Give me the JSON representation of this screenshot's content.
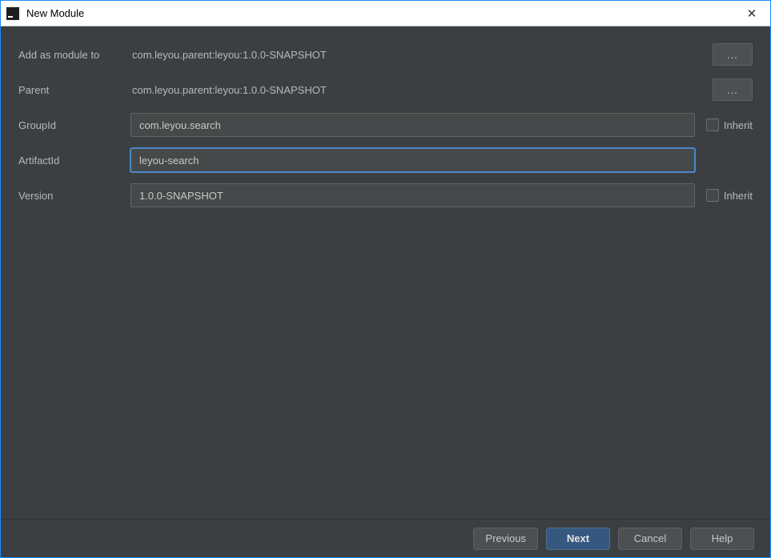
{
  "window": {
    "title": "New Module",
    "close_glyph": "✕"
  },
  "form": {
    "add_module_label": "Add as module to",
    "add_module_value": "com.leyou.parent:leyou:1.0.0-SNAPSHOT",
    "parent_label": "Parent",
    "parent_value": "com.leyou.parent:leyou:1.0.0-SNAPSHOT",
    "groupid_label": "GroupId",
    "groupid_value": "com.leyou.search",
    "artifactid_label": "ArtifactId",
    "artifactid_value": "leyou-search",
    "version_label": "Version",
    "version_value": "1.0.0-SNAPSHOT",
    "inherit_label": "Inherit",
    "browse_label": "..."
  },
  "footer": {
    "previous": "Previous",
    "next": "Next",
    "cancel": "Cancel",
    "help": "Help"
  }
}
